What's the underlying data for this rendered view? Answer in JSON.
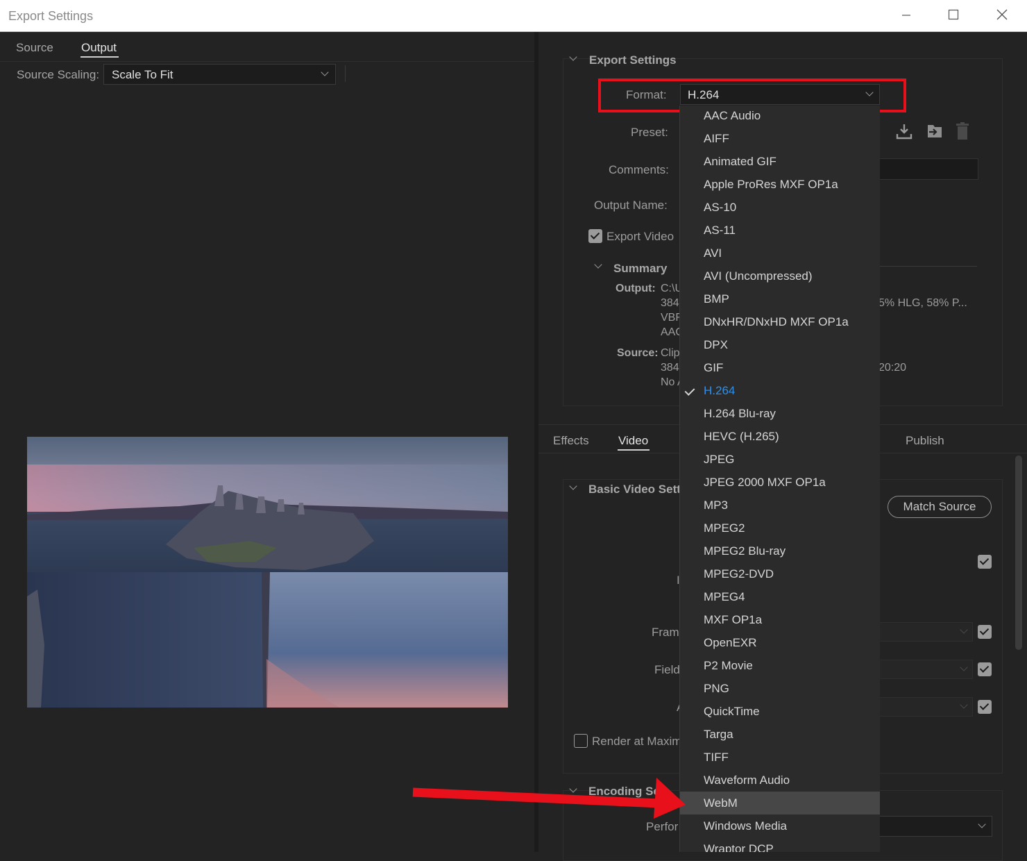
{
  "window": {
    "title": "Export Settings",
    "minimize_icon": "minimize-icon",
    "maximize_icon": "maximize-icon",
    "close_icon": "close-icon"
  },
  "left": {
    "tabs": [
      {
        "label": "Source"
      },
      {
        "label": "Output"
      }
    ],
    "source_scaling_label": "Source Scaling:",
    "source_scaling_value": "Scale To Fit"
  },
  "export_settings": {
    "section_title": "Export Settings",
    "format_label": "Format:",
    "format_value": "H.264",
    "preset_label": "Preset:",
    "comments_label": "Comments:",
    "output_name_label": "Output Name:",
    "export_video_label": "Export Video",
    "summary_title": "Summary",
    "output_label": "Output:",
    "output_lines": [
      "C:\\U",
      "384",
      "VBF",
      "AAC"
    ],
    "output_right": "5% HLG, 58% P...",
    "source_label": "Source:",
    "source_lines": [
      "Clip",
      "384",
      "No A"
    ],
    "source_right": "20:20"
  },
  "lower_tabs": [
    {
      "label": "Effects"
    },
    {
      "label": "Video"
    },
    {
      "label": "Publish"
    }
  ],
  "video": {
    "basic_title": "Basic Video Setti",
    "match_source": "Match Source",
    "frame_label": "Fram",
    "field_label": "Field",
    "render_max_label": "Render at Maxim",
    "encoding_title": "Encoding Set",
    "perf_label": "Perfor"
  },
  "format_menu": {
    "items": [
      "AAC Audio",
      "AIFF",
      "Animated GIF",
      "Apple ProRes MXF OP1a",
      "AS-10",
      "AS-11",
      "AVI",
      "AVI (Uncompressed)",
      "BMP",
      "DNxHR/DNxHD MXF OP1a",
      "DPX",
      "GIF",
      "H.264",
      "H.264 Blu-ray",
      "HEVC (H.265)",
      "JPEG",
      "JPEG 2000 MXF OP1a",
      "MP3",
      "MPEG2",
      "MPEG2 Blu-ray",
      "MPEG2-DVD",
      "MPEG4",
      "MXF OP1a",
      "OpenEXR",
      "P2 Movie",
      "PNG",
      "QuickTime",
      "Targa",
      "TIFF",
      "Waveform Audio",
      "WebM",
      "Windows Media",
      "Wraptor DCP"
    ],
    "selected": "H.264",
    "highlighted": "WebM"
  },
  "colors": {
    "highlight_red": "#e8101a",
    "selected_blue": "#2f8fe8"
  }
}
